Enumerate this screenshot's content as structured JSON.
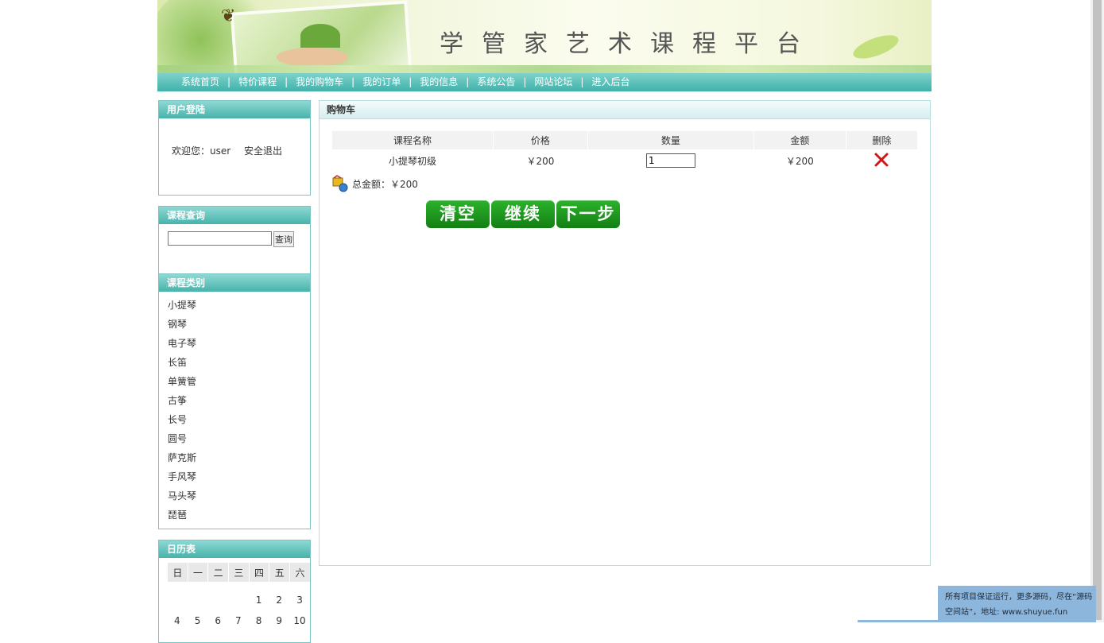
{
  "banner": {
    "title": "学管家艺术课程平台"
  },
  "nav": {
    "items": [
      "系统首页",
      "特价课程",
      "我的购物车",
      "我的订单",
      "我的信息",
      "系统公告",
      "网站论坛",
      "进入后台"
    ],
    "separator": "|"
  },
  "login": {
    "title": "用户登陆",
    "welcome": "欢迎您：user",
    "logout": "安全退出"
  },
  "search": {
    "title": "课程查询",
    "button": "查询",
    "value": ""
  },
  "categories": {
    "title": "课程类别",
    "items": [
      "小提琴",
      "钢琴",
      "电子琴",
      "长笛",
      "单簧管",
      "古筝",
      "长号",
      "圆号",
      "萨克斯",
      "手风琴",
      "马头琴",
      "琵琶"
    ]
  },
  "calendar": {
    "title": "日历表",
    "weekdays": [
      "日",
      "一",
      "二",
      "三",
      "四",
      "五",
      "六"
    ],
    "rows": [
      [
        "",
        "",
        "",
        "",
        "1",
        "2",
        "3"
      ],
      [
        "4",
        "5",
        "6",
        "7",
        "8",
        "9",
        "10"
      ]
    ]
  },
  "cart": {
    "title": "购物车",
    "headers": {
      "name": "课程名称",
      "price": "价格",
      "qty": "数量",
      "amount": "金额",
      "delete": "删除"
    },
    "rows": [
      {
        "name": "小提琴初级",
        "price": "￥200",
        "qty": "1",
        "amount": "￥200"
      }
    ],
    "total_label": "总金额：",
    "total_value": "￥200",
    "buttons": {
      "clear": "清空",
      "continue": "继续",
      "next": "下一步"
    }
  },
  "notice": {
    "text1": "所有项目保证运行，更多源码，尽在“源码",
    "text2": "空间站”，地址: www.shuyue.fun"
  }
}
